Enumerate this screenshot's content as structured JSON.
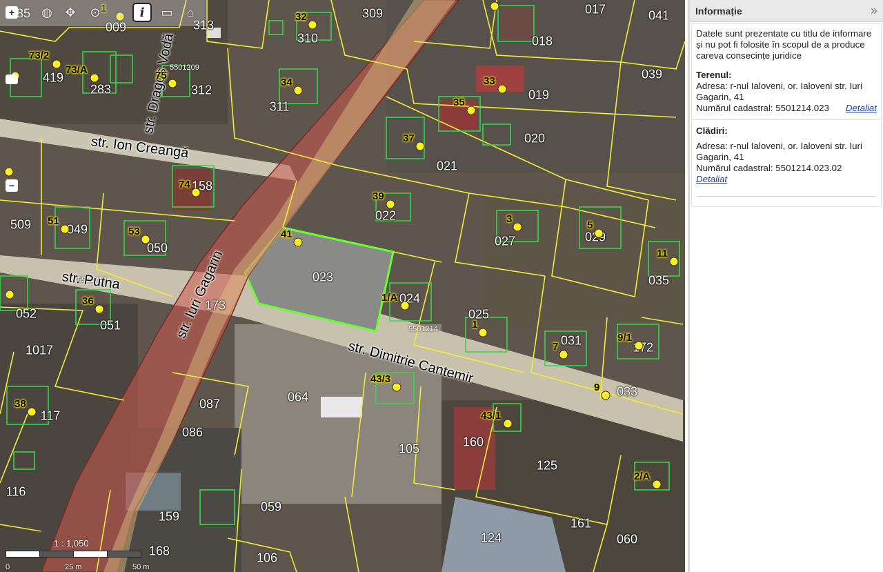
{
  "colors": {
    "parcel_border": "#f0ec3a",
    "building_border": "#36d64a",
    "selected_parcel": "#66ff33",
    "road_buffer": "#c0504d",
    "address_point": "#ffee22"
  },
  "toolbar": {
    "zoom_in": "+",
    "zoom_out": "−",
    "tools": [
      "globe-icon",
      "pan-icon",
      "zoom-icon",
      "info-icon",
      "measure-icon",
      "print-icon"
    ]
  },
  "scale": {
    "ratio": "1 : 1,050",
    "ticks": [
      "0",
      "25 m",
      "50 m"
    ]
  },
  "streets": [
    {
      "name": "str. Dragoș Vodă"
    },
    {
      "name": "str. Ion Creangă"
    },
    {
      "name": "str. Putna"
    },
    {
      "name": "str. Iuri Gagarin"
    },
    {
      "name": "str. Dimitrie Cantemir"
    }
  ],
  "parcels": [
    "009",
    "313",
    "309",
    "017",
    "041",
    "310",
    "018",
    "039",
    "419",
    "283",
    "312",
    "311",
    "019",
    "020",
    "021",
    "158",
    "022",
    "027",
    "029",
    "509",
    "049",
    "050",
    "023",
    "024",
    "025",
    "031",
    "172",
    "035",
    "052",
    "051",
    "173",
    "1017",
    "064",
    "033",
    "087",
    "117",
    "086",
    "105",
    "160",
    "125",
    "116",
    "159",
    "059",
    "161",
    "060",
    "124",
    "168",
    "106",
    "035",
    "85"
  ],
  "addresses": [
    "1",
    "32",
    "73/2",
    "73/A",
    "75",
    "34",
    "33",
    "35",
    "37",
    "74",
    "39",
    "41",
    "3",
    "5",
    "51",
    "53",
    "11",
    "36",
    "1/A",
    "1",
    "7",
    "9/1",
    "43/3",
    "9",
    "38",
    "43/1",
    "2/A",
    "1",
    "51"
  ],
  "block_codes": [
    "5501209",
    "5501214",
    "5501212"
  ],
  "panel": {
    "title": "Informație",
    "collapse_icon": "»",
    "disclaimer": "Datele sunt prezentate cu titlu de informare și nu pot fi folosite în scopul de a produce careva consecințe juridice",
    "land_heading": "Terenul:",
    "land_address": "Adresa: r-nul Ialoveni, or. Ialoveni str. Iuri Gagarin, 41",
    "land_cadastral": "Numărul cadastral: 5501214.023",
    "land_link": "Detaliat",
    "buildings_heading": "Clădiri:",
    "building_address": "Adresa: r-nul Ialoveni, or. Ialoveni str. Iuri Gagarin, 41",
    "building_cadastral": "Numărul cadastral: 5501214.023.02",
    "building_link": "Detaliat"
  }
}
